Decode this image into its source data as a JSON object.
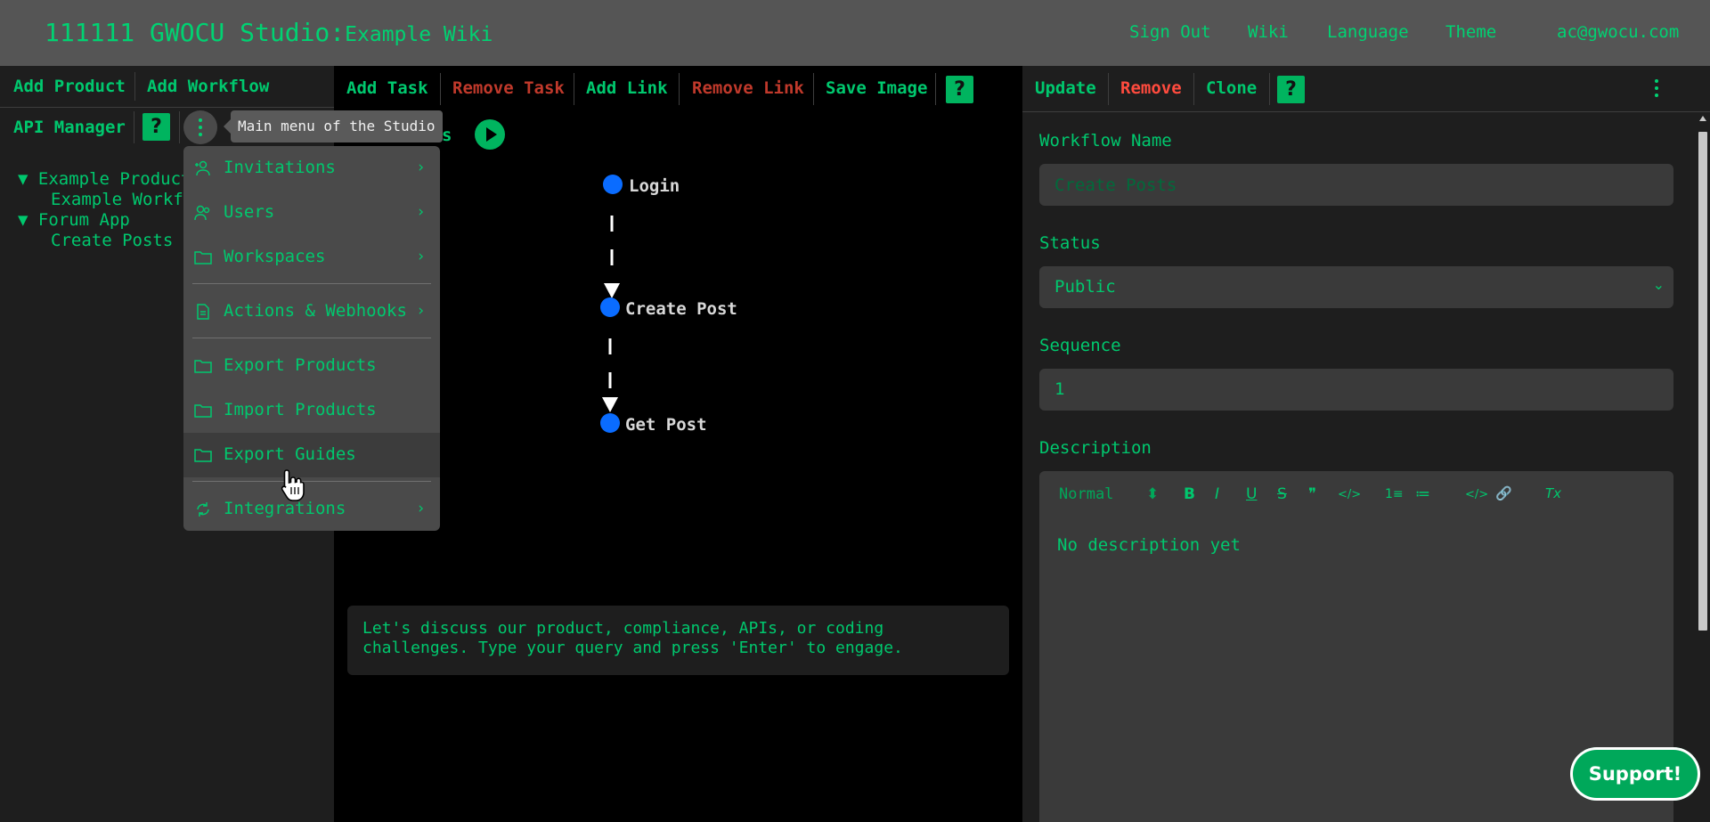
{
  "header": {
    "title": "111111 GWOCU Studio:",
    "subtitle": "Example Wiki",
    "nav": [
      "Sign Out",
      "Wiki",
      "Language",
      "Theme",
      "ac@gwocu.com"
    ]
  },
  "left_panel": {
    "buttons": {
      "add_product": "Add Product",
      "add_workflow": "Add Workflow",
      "api_manager": "API Manager",
      "help": "?"
    },
    "tooltip": "Main menu of the Studio",
    "tree": [
      {
        "label": "▼ Example Product",
        "level": 0
      },
      {
        "label": "Example Workflow",
        "level": 1
      },
      {
        "label": "▼ Forum App",
        "level": 0
      },
      {
        "label": "Create Posts",
        "level": 1
      }
    ]
  },
  "main_menu": {
    "items": [
      {
        "label": "Invitations",
        "icon": "people-add-icon",
        "has_submenu": true
      },
      {
        "label": "Users",
        "icon": "people-icon",
        "has_submenu": true
      },
      {
        "label": "Workspaces",
        "icon": "folder-icon",
        "has_submenu": true
      },
      {
        "label": "Actions & Webhooks",
        "icon": "document-icon",
        "has_submenu": true
      },
      {
        "label": "Export Products",
        "icon": "folder-icon",
        "has_submenu": false
      },
      {
        "label": "Import Products",
        "icon": "folder-icon",
        "has_submenu": false
      },
      {
        "label": "Export Guides",
        "icon": "folder-icon",
        "has_submenu": false,
        "hovered": true
      },
      {
        "label": "Integrations",
        "icon": "sync-icon",
        "has_submenu": true
      }
    ],
    "chevron": "›"
  },
  "middle_panel": {
    "toolbar": {
      "add_task": "Add Task",
      "remove_task": "Remove Task",
      "add_link": "Add Link",
      "remove_link": "Remove Link",
      "save_image": "Save Image",
      "help": "?"
    },
    "partial_title": "s",
    "workflow_nodes": [
      "Login",
      "Create Post",
      "Get Post"
    ],
    "chat_text": "Let's discuss our product, compliance, APIs, or coding challenges. Type your query and press 'Enter' to engage."
  },
  "right_panel": {
    "toolbar": {
      "update": "Update",
      "remove": "Remove",
      "clone": "Clone",
      "help": "?"
    },
    "workflow_name_label": "Workflow Name",
    "workflow_name_placeholder": "Create Posts",
    "status_label": "Status",
    "status_value": "Public",
    "sequence_label": "Sequence",
    "sequence_value": "1",
    "description_label": "Description",
    "editor_toolbar": {
      "heading": "Normal",
      "bold": "B",
      "italic": "I",
      "underline": "U",
      "strike": "S",
      "quote": "❞",
      "code": "</>",
      "ordered_list": "1≡",
      "bullet_list": "≔",
      "code_block": "</>",
      "link": "🔗",
      "clear": "Tx"
    },
    "description_text": "No description yet"
  },
  "support_button": "Support!",
  "colors": {
    "accent": "#00c86e",
    "danger": "#c0392b",
    "header_bg": "#555555",
    "panel_bg": "#1e1e1e",
    "node_blue": "#0a6cff"
  }
}
